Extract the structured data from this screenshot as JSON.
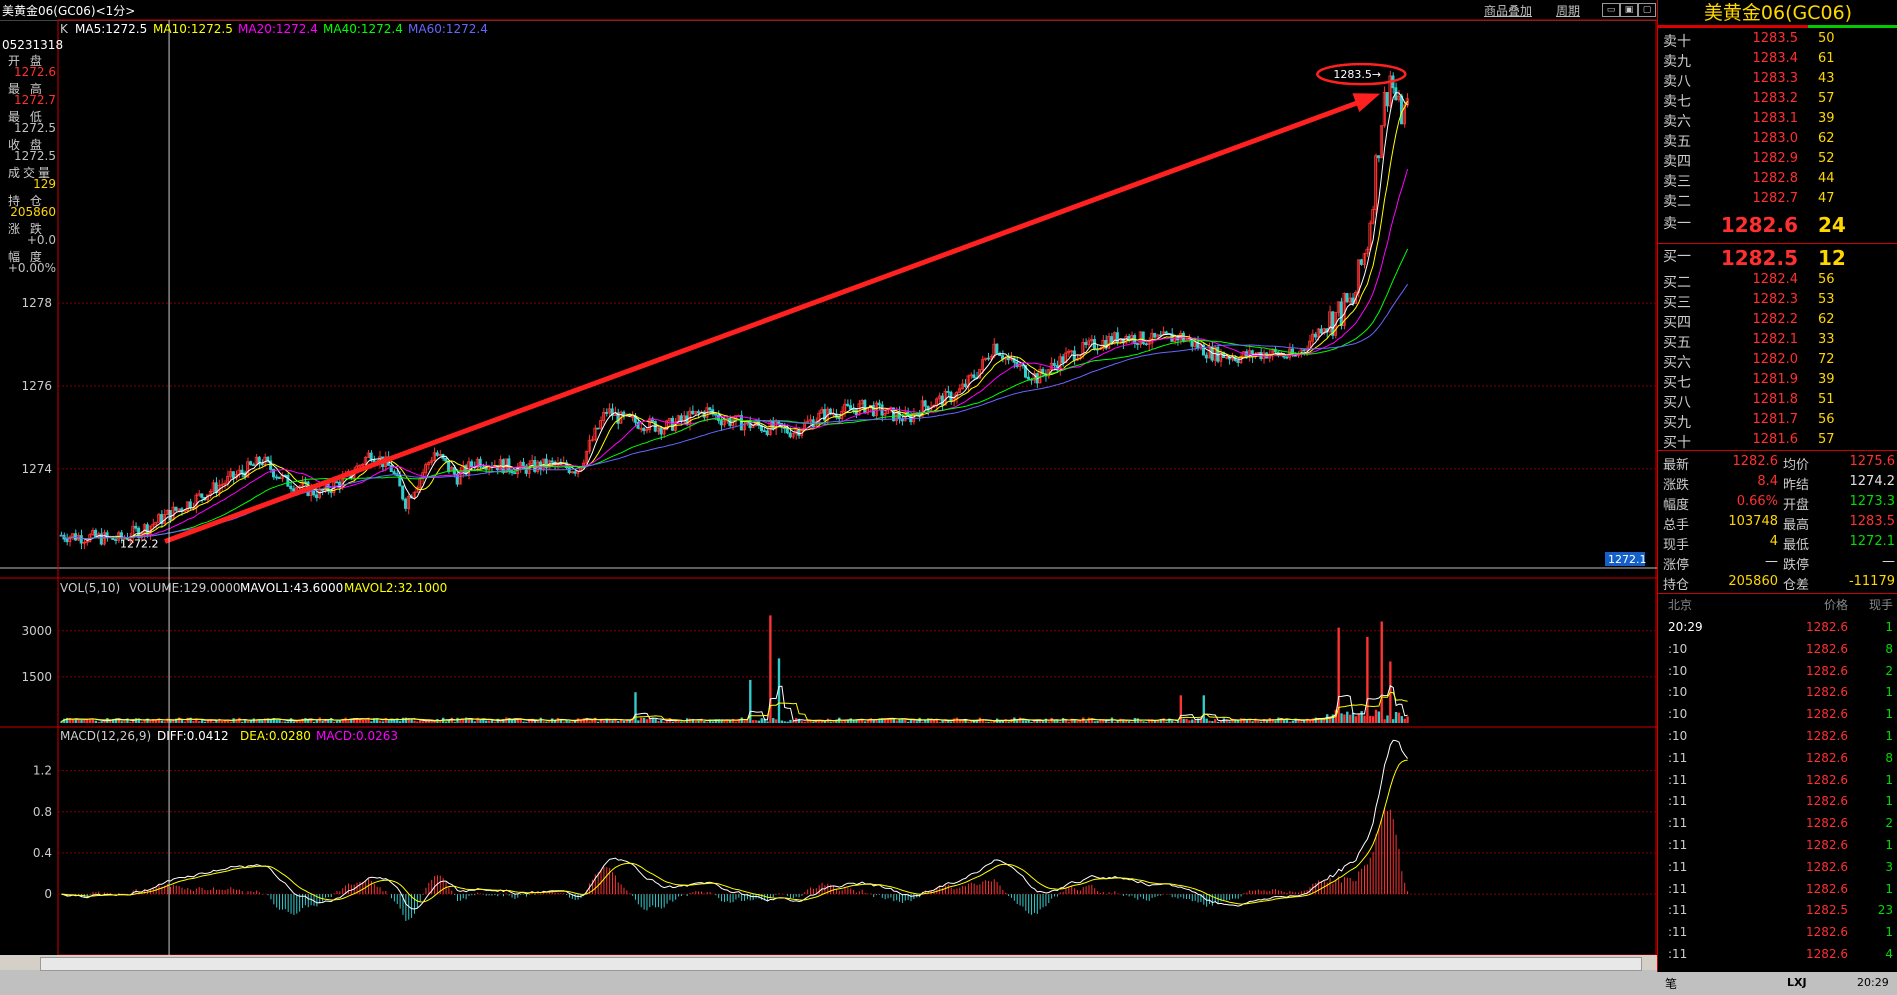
{
  "window": {
    "title": "美黄金06(GC06)<1分>",
    "overlay_link": "商品叠加",
    "period_link": "周期"
  },
  "colors": {
    "up": "#ff3333",
    "down": "#33cccc",
    "ma5": "#ffffff",
    "ma10": "#ffff00",
    "ma20": "#ff00ff",
    "ma40": "#00ff00",
    "ma60": "#6666ff",
    "grid": "#800000",
    "arrow": "#ff2020"
  },
  "left_info": {
    "time": "05231318",
    "items": [
      {
        "label": "开 盘",
        "value": "1272.6",
        "color": "#ff3030"
      },
      {
        "label": "最 高",
        "value": "1272.7",
        "color": "#ff3030"
      },
      {
        "label": "最 低",
        "value": "1272.5",
        "color": "#c0c0c0"
      },
      {
        "label": "收 盘",
        "value": "1272.5",
        "color": "#c0c0c0"
      },
      {
        "label": "成交量",
        "value": "129",
        "color": "#ffd700"
      },
      {
        "label": "持 仓",
        "value": "205860",
        "color": "#ffd700"
      },
      {
        "label": "涨 跌",
        "value": "+0.0",
        "color": "#c0c0c0"
      },
      {
        "label": "幅 度",
        "value": "+0.00%",
        "color": "#c0c0c0"
      }
    ]
  },
  "main_legend": {
    "k": "K",
    "ma5": "MA5:1272.5",
    "ma10": "MA10:1272.5",
    "ma20": "MA20:1272.4",
    "ma40": "MA40:1272.4",
    "ma60": "MA60:1272.4"
  },
  "vol_legend": {
    "a": "VOL(5,10)",
    "b": "VOLUME:129.0000",
    "c": "MAVOL1:43.6000",
    "d": "MAVOL2:32.1000"
  },
  "macd_legend": {
    "a": "MACD(12,26,9)",
    "b": "DIFF:0.0412",
    "c": "DEA:0.0280",
    "d": "MACD:0.0263"
  },
  "annotations": {
    "high_marker": "1283.5→",
    "low_marker": "1272.2",
    "right_price_tag": "1272.1",
    "cursor_time": "05-23 13:18",
    "period_label": "1分",
    "date_label": "0523"
  },
  "chart_data": [
    {
      "type": "candlestick",
      "name": "price",
      "y_ticks": [
        1274,
        1276,
        1278
      ],
      "ylim": [
        1272,
        1284
      ],
      "n_bars": 300,
      "start_price": 1272.4,
      "waypoints": [
        [
          0,
          1272.4
        ],
        [
          20,
          1272.3
        ],
        [
          30,
          1272.6
        ],
        [
          55,
          1273.6
        ],
        [
          70,
          1274.2
        ],
        [
          78,
          1273.7
        ],
        [
          90,
          1273.4
        ],
        [
          100,
          1273.8
        ],
        [
          108,
          1274.4
        ],
        [
          115,
          1274.0
        ],
        [
          120,
          1273.2
        ],
        [
          130,
          1274.4
        ],
        [
          138,
          1273.8
        ],
        [
          145,
          1274.2
        ],
        [
          160,
          1274.0
        ],
        [
          170,
          1274.1
        ],
        [
          180,
          1274.0
        ],
        [
          190,
          1275.4
        ],
        [
          195,
          1275.2
        ],
        [
          210,
          1275.0
        ],
        [
          225,
          1275.4
        ],
        [
          230,
          1275.2
        ],
        [
          245,
          1275.0
        ],
        [
          255,
          1274.9
        ],
        [
          265,
          1275.3
        ],
        [
          280,
          1275.5
        ],
        [
          295,
          1275.2
        ],
        [
          300,
          1275.5
        ]
      ],
      "extended_waypoints": [
        [
          300,
          1275.5
        ],
        [
          312,
          1275.8
        ],
        [
          320,
          1276.4
        ],
        [
          325,
          1277.0
        ],
        [
          330,
          1276.6
        ],
        [
          340,
          1276.2
        ],
        [
          350,
          1276.7
        ],
        [
          360,
          1277.0
        ],
        [
          370,
          1277.2
        ],
        [
          380,
          1277.1
        ],
        [
          390,
          1277.2
        ],
        [
          400,
          1276.8
        ],
        [
          410,
          1276.7
        ],
        [
          420,
          1276.8
        ],
        [
          430,
          1276.7
        ],
        [
          440,
          1277.5
        ],
        [
          450,
          1278.0
        ],
        [
          455,
          1279.5
        ],
        [
          460,
          1282.5
        ],
        [
          463,
          1283.5
        ],
        [
          466,
          1282.6
        ]
      ],
      "high": 1283.5,
      "low": 1272.2
    },
    {
      "type": "bar",
      "name": "volume",
      "y_ticks": [
        1500,
        3000
      ],
      "ylim": [
        0,
        4000
      ],
      "spikes": [
        [
          200,
          1000
        ],
        [
          240,
          1400
        ],
        [
          247,
          3500
        ],
        [
          250,
          2100
        ],
        [
          390,
          900
        ],
        [
          398,
          900
        ],
        [
          445,
          3100
        ],
        [
          455,
          2800
        ],
        [
          460,
          3300
        ],
        [
          463,
          2000
        ]
      ],
      "baseline": 120
    },
    {
      "type": "bar",
      "name": "macd",
      "y_ticks": [
        0,
        0.4,
        0.8,
        1.2
      ],
      "ylim": [
        -0.3,
        1.4
      ],
      "diff_end": 1.38,
      "dea_end": 0.98
    }
  ],
  "right_panel": {
    "title": "美黄金06(GC06)",
    "asks": [
      {
        "label": "卖十",
        "price": "1283.5",
        "vol": "50"
      },
      {
        "label": "卖九",
        "price": "1283.4",
        "vol": "61"
      },
      {
        "label": "卖八",
        "price": "1283.3",
        "vol": "43"
      },
      {
        "label": "卖七",
        "price": "1283.2",
        "vol": "57"
      },
      {
        "label": "卖六",
        "price": "1283.1",
        "vol": "39"
      },
      {
        "label": "卖五",
        "price": "1283.0",
        "vol": "62"
      },
      {
        "label": "卖四",
        "price": "1282.9",
        "vol": "52"
      },
      {
        "label": "卖三",
        "price": "1282.8",
        "vol": "44"
      },
      {
        "label": "卖二",
        "price": "1282.7",
        "vol": "47"
      },
      {
        "label": "卖一",
        "price": "1282.6",
        "vol": "24"
      }
    ],
    "bids": [
      {
        "label": "买一",
        "price": "1282.5",
        "vol": "12"
      },
      {
        "label": "买二",
        "price": "1282.4",
        "vol": "56"
      },
      {
        "label": "买三",
        "price": "1282.3",
        "vol": "53"
      },
      {
        "label": "买四",
        "price": "1282.2",
        "vol": "62"
      },
      {
        "label": "买五",
        "price": "1282.1",
        "vol": "33"
      },
      {
        "label": "买六",
        "price": "1282.0",
        "vol": "72"
      },
      {
        "label": "买七",
        "price": "1281.9",
        "vol": "39"
      },
      {
        "label": "买八",
        "price": "1281.8",
        "vol": "51"
      },
      {
        "label": "买九",
        "price": "1281.7",
        "vol": "56"
      },
      {
        "label": "买十",
        "price": "1281.6",
        "vol": "57"
      }
    ],
    "stats": [
      {
        "l": "最新",
        "lv": "1282.6",
        "lc": "#ff3030",
        "r": "均价",
        "rv": "1275.6",
        "rc": "#ff3030"
      },
      {
        "l": "涨跌",
        "lv": "8.4",
        "lc": "#ff3030",
        "r": "昨结",
        "rv": "1274.2",
        "rc": "#e0e0e0"
      },
      {
        "l": "幅度",
        "lv": "0.66%",
        "lc": "#ff3030",
        "r": "开盘",
        "rv": "1273.3",
        "rc": "#00dd00"
      },
      {
        "l": "总手",
        "lv": "103748",
        "lc": "#ffd700",
        "r": "最高",
        "rv": "1283.5",
        "rc": "#ff3030"
      },
      {
        "l": "现手",
        "lv": "4",
        "lc": "#ffd700",
        "r": "最低",
        "rv": "1272.1",
        "rc": "#00dd00"
      },
      {
        "l": "涨停",
        "lv": "—",
        "lc": "#e0e0e0",
        "r": "跌停",
        "rv": "—",
        "rc": "#e0e0e0"
      },
      {
        "l": "持仓",
        "lv": "205860",
        "lc": "#ffd700",
        "r": "仓差",
        "rv": "-11179",
        "rc": "#ffd700"
      }
    ],
    "ticks_header": {
      "t": "北京",
      "p": "价格",
      "v": "现手"
    },
    "ticks": [
      {
        "t": "20:29",
        "p": "1282.6",
        "v": "1"
      },
      {
        "t": ":10",
        "p": "1282.6",
        "v": "8"
      },
      {
        "t": ":10",
        "p": "1282.6",
        "v": "2"
      },
      {
        "t": ":10",
        "p": "1282.6",
        "v": "1"
      },
      {
        "t": ":10",
        "p": "1282.6",
        "v": "1"
      },
      {
        "t": ":10",
        "p": "1282.6",
        "v": "1"
      },
      {
        "t": ":11",
        "p": "1282.6",
        "v": "8"
      },
      {
        "t": ":11",
        "p": "1282.6",
        "v": "1"
      },
      {
        "t": ":11",
        "p": "1282.6",
        "v": "1"
      },
      {
        "t": ":11",
        "p": "1282.6",
        "v": "2"
      },
      {
        "t": ":11",
        "p": "1282.6",
        "v": "1"
      },
      {
        "t": ":11",
        "p": "1282.6",
        "v": "3"
      },
      {
        "t": ":11",
        "p": "1282.6",
        "v": "1"
      },
      {
        "t": ":11",
        "p": "1282.5",
        "v": "23"
      },
      {
        "t": ":11",
        "p": "1282.6",
        "v": "1"
      },
      {
        "t": ":11",
        "p": "1282.6",
        "v": "4"
      }
    ],
    "tab_label": "笔",
    "status_time": "20:29",
    "status_label": "LXJ"
  }
}
